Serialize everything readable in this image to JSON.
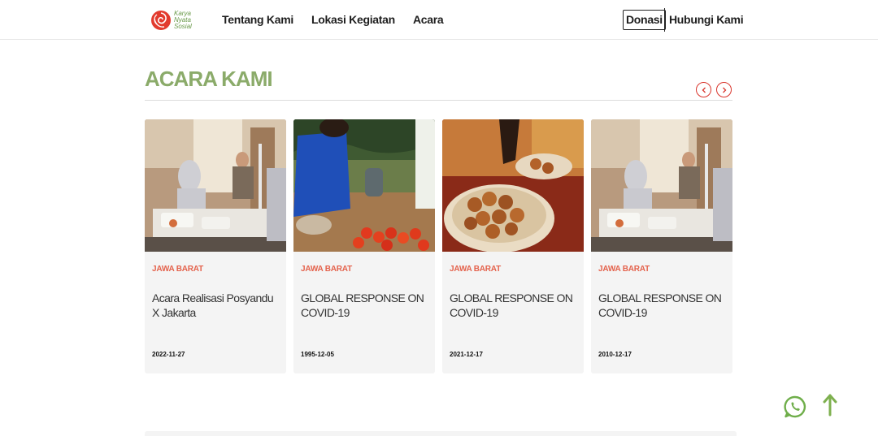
{
  "brand": {
    "logo_text": [
      "Karya",
      "Nyata",
      "Sosial"
    ]
  },
  "nav": {
    "items": [
      "Tentang Kami",
      "Lokasi Kegiatan",
      "Acara"
    ]
  },
  "header_actions": {
    "donate_label": "Donasi",
    "contact_label": "Hubungi Kami"
  },
  "section": {
    "title": "ACARA KAMI",
    "prev_icon": "chevron-left-icon",
    "next_icon": "chevron-right-icon"
  },
  "events": [
    {
      "region": "JAWA BARAT",
      "title": "Acara Realisasi Posyandu X Jakarta",
      "date": "2022-11-27",
      "image": "volunteers-food-distribution"
    },
    {
      "region": "JAWA BARAT",
      "title": "GLOBAL RESPONSE ON COVID-19",
      "date": "1995-12-05",
      "image": "market-vendor-tomatoes"
    },
    {
      "region": "JAWA BARAT",
      "title": "GLOBAL RESPONSE ON COVID-19",
      "date": "2021-12-17",
      "image": "bowl-of-fried-food"
    },
    {
      "region": "JAWA BARAT",
      "title": "GLOBAL RESPONSE ON COVID-19",
      "date": "2010-12-17",
      "image": "volunteers-food-distribution"
    }
  ],
  "floating": {
    "whatsapp_icon": "whatsapp-icon",
    "scroll_top_icon": "arrow-up-icon"
  },
  "colors": {
    "accent_green": "#8bab6a",
    "accent_red": "#d9342b",
    "region_red": "#e4624c",
    "card_bg": "#f4f4f4"
  }
}
